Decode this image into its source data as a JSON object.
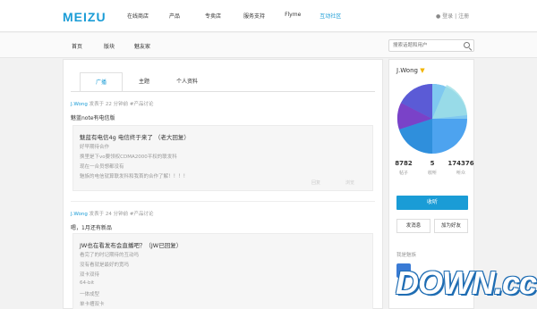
{
  "header": {
    "logo": "MEIZU",
    "nav": [
      "在线商店",
      "产品",
      "专卖店",
      "服务支持",
      "Flyme",
      "互动社区"
    ],
    "active_nav": "互动社区",
    "login": "登录",
    "separator": "|",
    "register": "注册"
  },
  "subnav": {
    "breadcrumb": [
      "首页",
      "版块",
      "魅友家"
    ],
    "search_placeholder": "搜索话题和用户"
  },
  "tabs": [
    "广播",
    "主题",
    "个人资料"
  ],
  "posts": [
    {
      "author": "J.Wong",
      "meta": "发表于 22 分钟前  #产品讨论",
      "title": "魅蓝note有电信版",
      "quote_title": "魅蓝有电信4g 电信终于来了 （老大回复）",
      "quote_lines": [
        "好早期待合作",
        "换里是下vo要领权CDMA2000平权的联发科",
        "现在一合员想都没有",
        "魅族的电信就算联发科和我首的合作了解！！！！"
      ],
      "actions": [
        "回复",
        "浏览"
      ]
    },
    {
      "author": "J.Wong",
      "meta": "发表于 24 分钟前  #产品讨论",
      "title": "嗯，1月还有新品",
      "quote_title": "JW也在看发布会直播吧？（JW已回复）",
      "quote_lines": [
        "看完了的时记期待的互动吗",
        "没有看就是最好的宽吗",
        "双卡双待",
        "64-bit",
        "一体成型",
        "单卡槽双卡"
      ]
    }
  ],
  "profile": {
    "name": "J.Wong",
    "verified_icon": "crown-icon",
    "stats": [
      {
        "value": "8782",
        "label": "帖子"
      },
      {
        "value": "5",
        "label": "收听"
      },
      {
        "value": "174376",
        "label": "听众"
      }
    ],
    "follow": "收听",
    "message": "发消息",
    "add_friend": "加为好友",
    "section_title": "我是魅族"
  },
  "watermark": "DOWN.cc",
  "colors": {
    "accent": "#1a9cd6"
  }
}
